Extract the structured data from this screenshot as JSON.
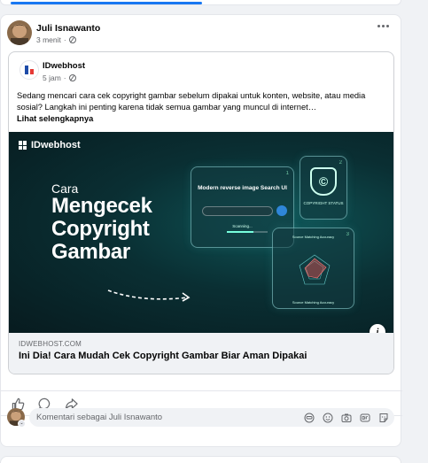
{
  "post": {
    "author": "Juli Isnawanto",
    "time": "3 menit",
    "separator": "·",
    "shared": {
      "author": "IDwebhost",
      "time": "5 jam",
      "separator": "·",
      "text": "Sedang mencari cara cek copyright gambar sebelum dipakai untuk konten, website, atau media sosial? Langkah ini penting karena tidak semua gambar yang muncul di internet…",
      "see_more": "Lihat selengkapnya",
      "image": {
        "brand": "IDwebhost",
        "line1": "Cara",
        "line2": "Mengecek",
        "line3": "Copyright",
        "line4": "Gambar",
        "panel1_num": "1",
        "panel1_title": "Modern reverse image Search UI",
        "panel1_status": "Scanning...",
        "panel2_num": "2",
        "panel2_symbol": "©",
        "panel2_label": "COPYRIGHT STATUS",
        "panel3_num": "3",
        "panel3_title": "Source Matching Accuracy",
        "panel3_footer": "Source Matching Accuracy"
      },
      "link": {
        "domain": "IDWEBHOST.COM",
        "title": "Ini Dia! Cara Mudah Cek Copyright Gambar Biar Aman Dipakai"
      }
    }
  },
  "comment": {
    "placeholder": "Komentari sebagai Juli Isnawanto"
  },
  "icons": {
    "like": "thumbs-up-icon",
    "comment": "comment-bubble-icon",
    "share": "share-arrow-icon",
    "more": "more-dots-icon",
    "globe": "globe-icon",
    "info": "info-icon",
    "avatar_sticker": "avatar-sticker-icon",
    "emoji": "emoji-icon",
    "camera": "camera-icon",
    "gif": "gif-icon",
    "sticker": "sticker-icon"
  },
  "colors": {
    "accent": "#1877f2",
    "secondary_text": "#65676b",
    "banner_bg": "#0a2f33"
  }
}
